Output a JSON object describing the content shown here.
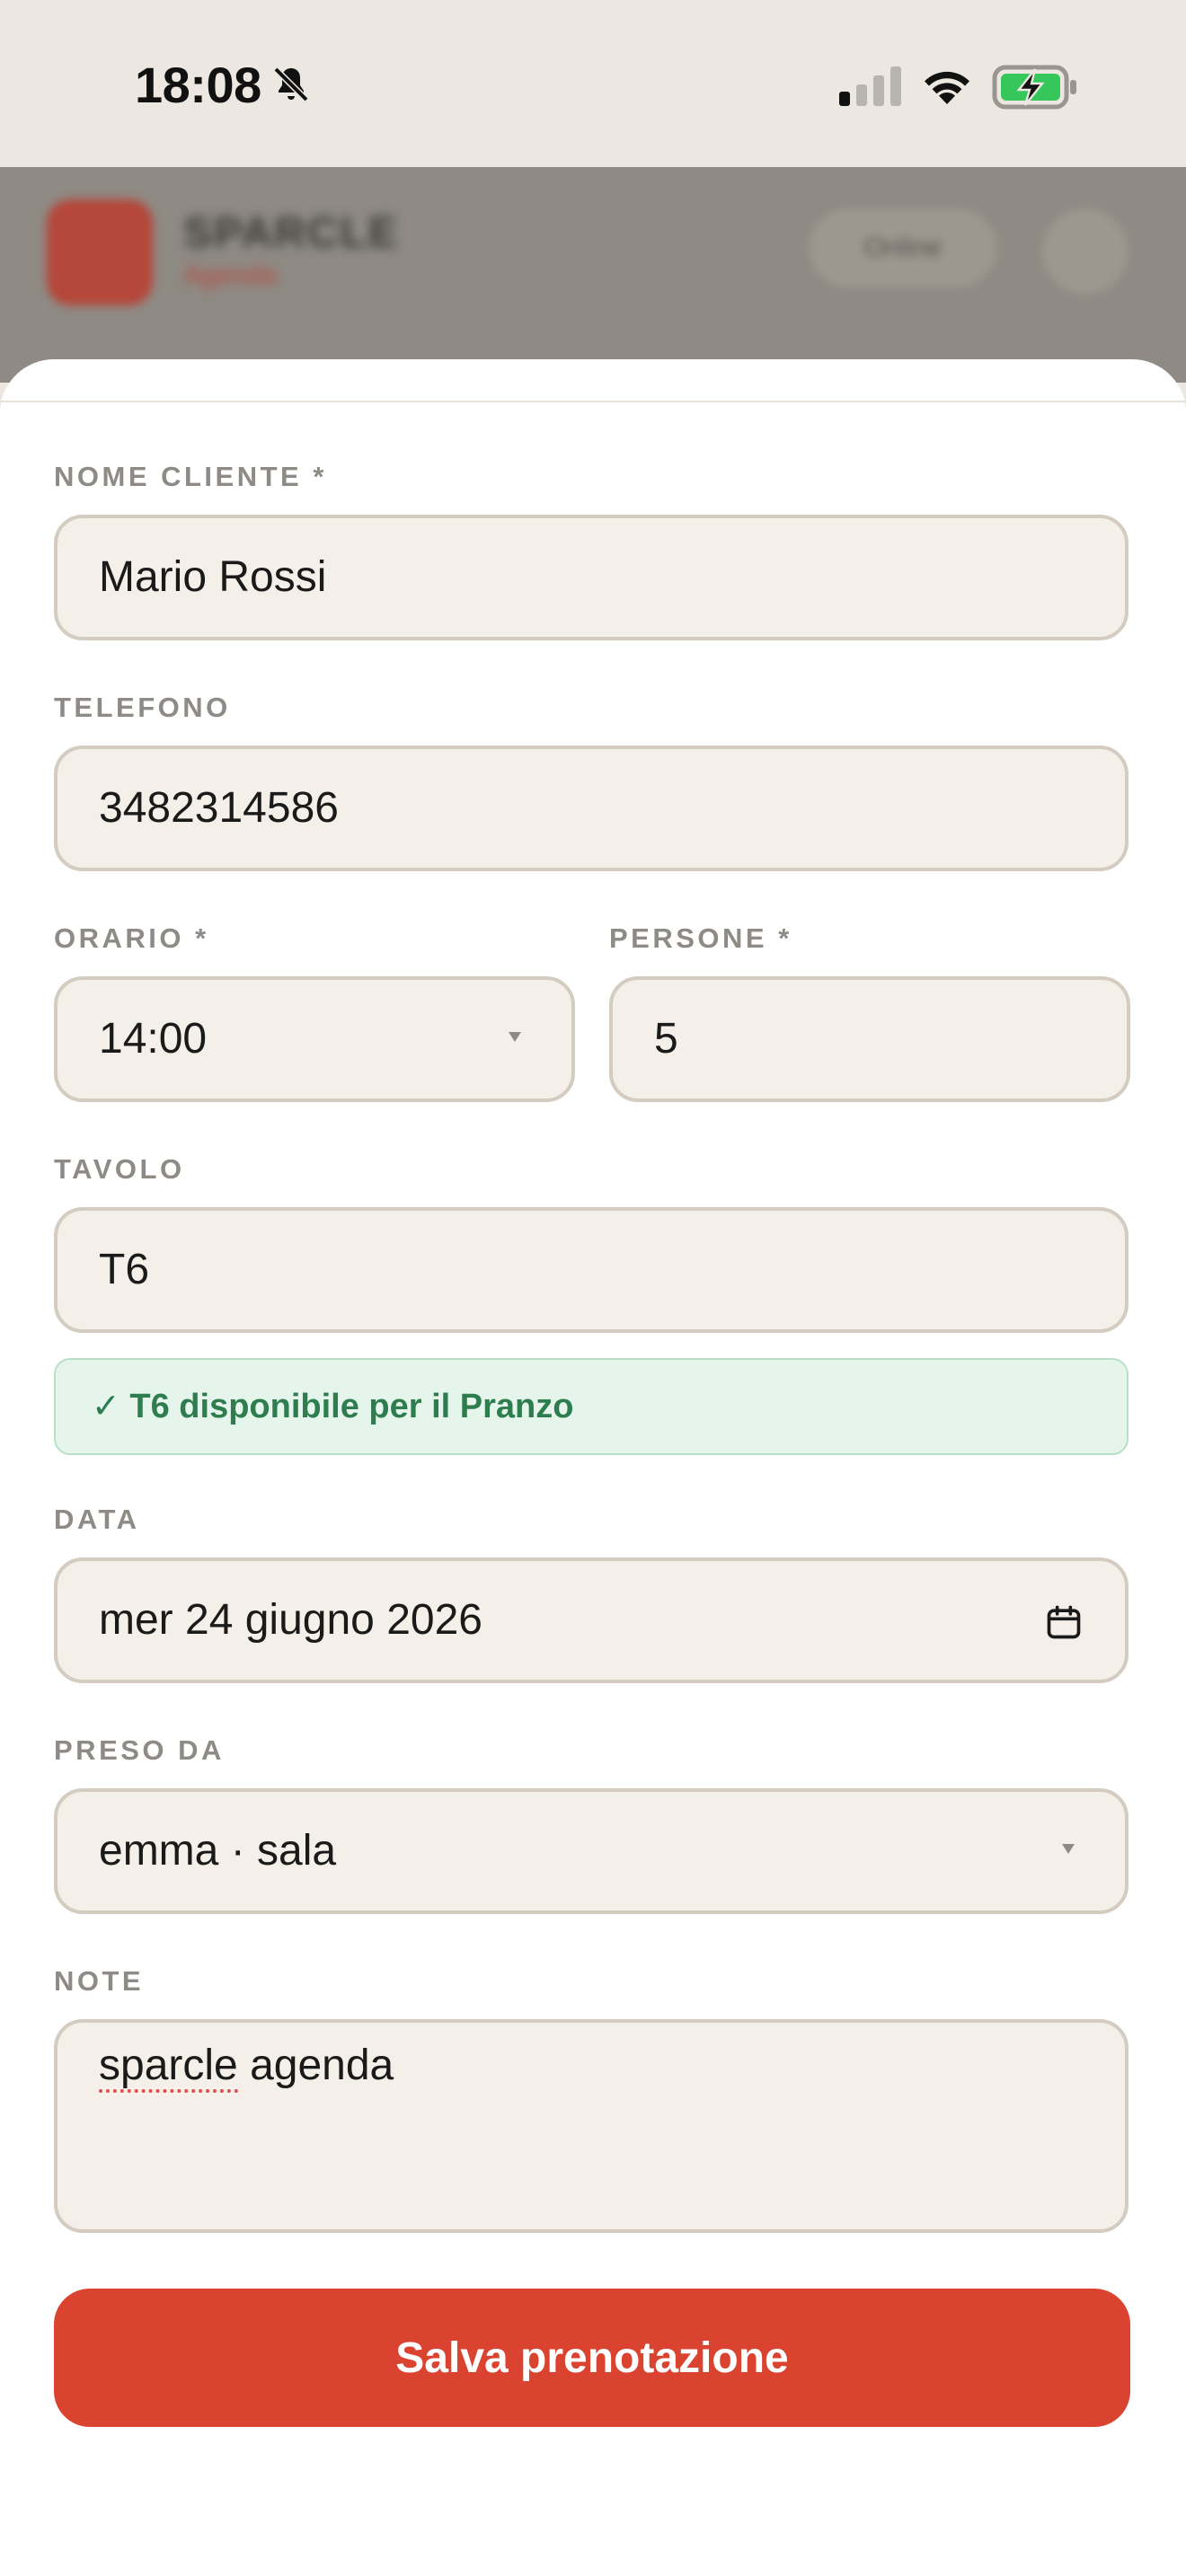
{
  "status_bar": {
    "time": "18:08"
  },
  "app_header": {
    "brand": "SPARCLE",
    "brand_sub": "Agenda",
    "status_pill": "Online"
  },
  "form": {
    "nome_cliente": {
      "label": "NOME CLIENTE *",
      "value": "Mario Rossi"
    },
    "telefono": {
      "label": "TELEFONO",
      "value": "3482314586"
    },
    "orario": {
      "label": "ORARIO *",
      "value": "14:00"
    },
    "persone": {
      "label": "PERSONE *",
      "value": "5"
    },
    "tavolo": {
      "label": "TAVOLO",
      "value": "T6"
    },
    "availability": "✓ T6 disponibile per il Pranzo",
    "data": {
      "label": "DATA",
      "value": "mer 24 giugno 2026"
    },
    "preso_da": {
      "label": "PRESO DA",
      "value": "emma · sala"
    },
    "note": {
      "label": "NOTE",
      "value_misspelled": "sparcle",
      "value_rest": " agenda"
    },
    "save_label": "Salva prenotazione"
  },
  "colors": {
    "accent": "#d9432f",
    "field_bg": "#f4efe8",
    "success_text": "#2e7d4f",
    "success_bg": "#e6f5ec"
  },
  "icons": [
    "bell-slash-icon",
    "cellular-signal-icon",
    "wifi-icon",
    "battery-charging-icon",
    "calendar-icon",
    "chevron-down-icon"
  ]
}
